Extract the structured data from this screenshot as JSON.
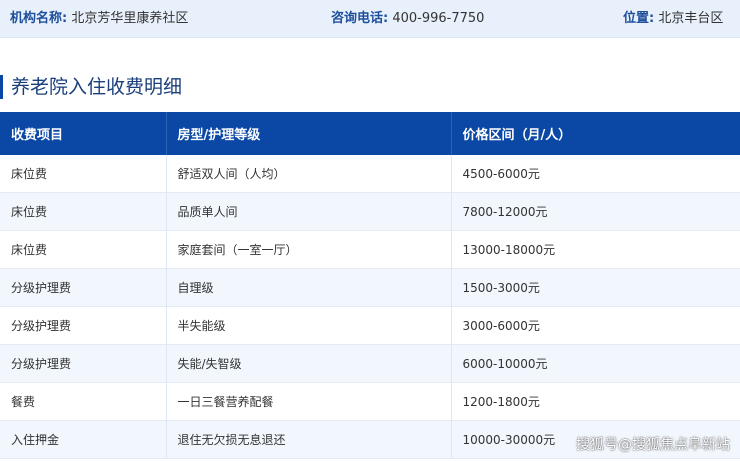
{
  "info_bar": {
    "name_label": "机构名称:",
    "name_value": "北京芳华里康养社区",
    "phone_label": "咨询电话:",
    "phone_value": "400-996-7750",
    "location_label": "位置:",
    "location_value": "北京丰台区"
  },
  "section": {
    "title": "养老院入住收费明细"
  },
  "table": {
    "headers": [
      "收费项目",
      "房型/护理等级",
      "价格区间（月/人）"
    ],
    "rows": [
      [
        "床位费",
        "舒适双人间（人均）",
        "4500-6000元"
      ],
      [
        "床位费",
        "品质单人间",
        "7800-12000元"
      ],
      [
        "床位费",
        "家庭套间（一室一厅）",
        "13000-18000元"
      ],
      [
        "分级护理费",
        "自理级",
        "1500-3000元"
      ],
      [
        "分级护理费",
        "半失能级",
        "3000-6000元"
      ],
      [
        "分级护理费",
        "失能/失智级",
        "6000-10000元"
      ],
      [
        "餐费",
        "一日三餐营养配餐",
        "1200-1800元"
      ],
      [
        "入住押金",
        "退住无欠损无息退还",
        "10000-30000元"
      ]
    ]
  },
  "watermark": "搜狐号@搜狐焦点阜新站",
  "colors": {
    "header_bg": "#0b48a6",
    "info_bg": "#e8f1fb",
    "stripe": "#f2f7fd"
  }
}
